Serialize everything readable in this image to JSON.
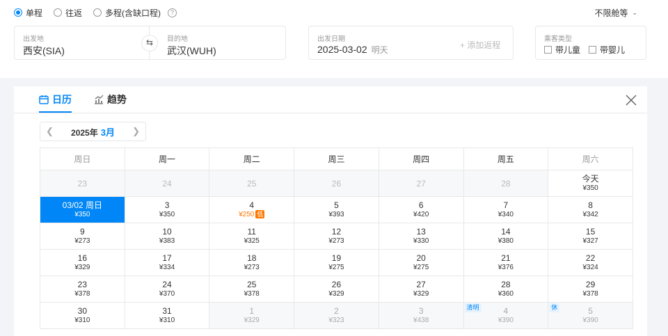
{
  "trip_types": [
    {
      "label": "单程",
      "checked": true
    },
    {
      "label": "往返",
      "checked": false
    },
    {
      "label": "多程(含缺口程)",
      "checked": false
    }
  ],
  "help_icon": "?",
  "cabin": {
    "label": "不限舱等"
  },
  "origin": {
    "label": "出发地",
    "value": "西安(SIA)"
  },
  "destination": {
    "label": "目的地",
    "value": "武汉(WUH)"
  },
  "depart": {
    "label": "出发日期",
    "date": "2025-03-02",
    "day_hint": "明天",
    "add_return": "+ 添加返程"
  },
  "passenger": {
    "label": "乘客类型",
    "child": "带儿童",
    "infant": "带婴儿"
  },
  "tabs": [
    {
      "label": "日历",
      "icon": "calendar-icon",
      "active": true
    },
    {
      "label": "趋势",
      "icon": "trend-chart-icon",
      "active": false
    }
  ],
  "month_nav": {
    "year": "2025年",
    "month": "3月"
  },
  "weekdays": [
    "周日",
    "周一",
    "周二",
    "周三",
    "周四",
    "周五",
    "周六"
  ],
  "accent_color": "#0086f6",
  "low_price_color": "#ff7700",
  "weeks": [
    [
      {
        "day": "23",
        "price": "",
        "state": "past"
      },
      {
        "day": "24",
        "price": "",
        "state": "past"
      },
      {
        "day": "25",
        "price": "",
        "state": "past"
      },
      {
        "day": "26",
        "price": "",
        "state": "past"
      },
      {
        "day": "27",
        "price": "",
        "state": "past"
      },
      {
        "day": "28",
        "price": "",
        "state": "past"
      },
      {
        "day": "今天",
        "price": "¥350",
        "state": ""
      }
    ],
    [
      {
        "day": "03/02 周日",
        "price": "¥350",
        "state": "sel"
      },
      {
        "day": "3",
        "price": "¥350",
        "state": ""
      },
      {
        "day": "4",
        "price": "¥250",
        "state": "low",
        "tag": "低"
      },
      {
        "day": "5",
        "price": "¥393",
        "state": ""
      },
      {
        "day": "6",
        "price": "¥420",
        "state": ""
      },
      {
        "day": "7",
        "price": "¥340",
        "state": ""
      },
      {
        "day": "8",
        "price": "¥342",
        "state": ""
      }
    ],
    [
      {
        "day": "9",
        "price": "¥273",
        "state": ""
      },
      {
        "day": "10",
        "price": "¥383",
        "state": ""
      },
      {
        "day": "11",
        "price": "¥325",
        "state": ""
      },
      {
        "day": "12",
        "price": "¥273",
        "state": ""
      },
      {
        "day": "13",
        "price": "¥330",
        "state": ""
      },
      {
        "day": "14",
        "price": "¥380",
        "state": ""
      },
      {
        "day": "15",
        "price": "¥327",
        "state": ""
      }
    ],
    [
      {
        "day": "16",
        "price": "¥329",
        "state": ""
      },
      {
        "day": "17",
        "price": "¥334",
        "state": ""
      },
      {
        "day": "18",
        "price": "¥273",
        "state": ""
      },
      {
        "day": "19",
        "price": "¥275",
        "state": ""
      },
      {
        "day": "20",
        "price": "¥275",
        "state": ""
      },
      {
        "day": "21",
        "price": "¥376",
        "state": ""
      },
      {
        "day": "22",
        "price": "¥324",
        "state": ""
      }
    ],
    [
      {
        "day": "23",
        "price": "¥378",
        "state": ""
      },
      {
        "day": "24",
        "price": "¥370",
        "state": ""
      },
      {
        "day": "25",
        "price": "¥378",
        "state": ""
      },
      {
        "day": "26",
        "price": "¥329",
        "state": ""
      },
      {
        "day": "27",
        "price": "¥329",
        "state": ""
      },
      {
        "day": "28",
        "price": "¥360",
        "state": ""
      },
      {
        "day": "29",
        "price": "¥378",
        "state": ""
      }
    ],
    [
      {
        "day": "30",
        "price": "¥310",
        "state": ""
      },
      {
        "day": "31",
        "price": "¥310",
        "state": ""
      },
      {
        "day": "1",
        "price": "¥329",
        "state": "dim"
      },
      {
        "day": "2",
        "price": "¥323",
        "state": "dim"
      },
      {
        "day": "3",
        "price": "¥438",
        "state": "dim"
      },
      {
        "day": "4",
        "price": "¥390",
        "state": "dim",
        "holiday": "清明"
      },
      {
        "day": "5",
        "price": "¥390",
        "state": "dim",
        "holiday": "休"
      }
    ]
  ]
}
